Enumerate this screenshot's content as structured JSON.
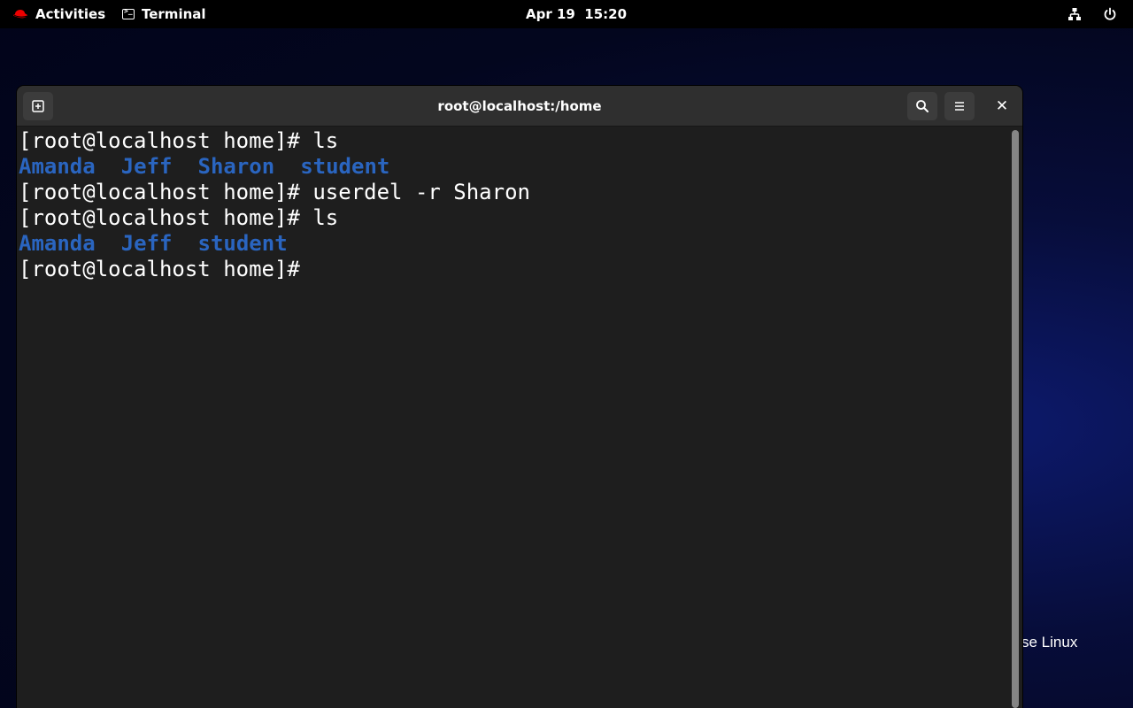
{
  "topbar": {
    "activities_label": "Activities",
    "app_label": "Terminal",
    "clock": "Apr 19  15:20",
    "icons": [
      "redhat-icon",
      "terminal-icon",
      "network-icon",
      "power-icon"
    ]
  },
  "desktop": {
    "background_text": "se Linux"
  },
  "window": {
    "title": "root@localhost:/home",
    "buttons": [
      "new-tab-icon",
      "search-icon",
      "hamburger-menu-icon",
      "close-icon"
    ],
    "close_glyph": "✕"
  },
  "terminal": {
    "colors": {
      "background": "#1e1e1e",
      "text": "#ffffff",
      "directory": "#2a65c0"
    },
    "lines": [
      {
        "prompt": "[root@localhost home]# ",
        "command": "ls"
      },
      {
        "dirs": [
          "Amanda",
          "Jeff",
          "Sharon",
          "student"
        ]
      },
      {
        "prompt": "[root@localhost home]# ",
        "command": "userdel -r Sharon"
      },
      {
        "prompt": "[root@localhost home]# ",
        "command": "ls"
      },
      {
        "dirs": [
          "Amanda",
          "Jeff",
          "student"
        ]
      },
      {
        "prompt": "[root@localhost home]#",
        "command": ""
      }
    ]
  }
}
